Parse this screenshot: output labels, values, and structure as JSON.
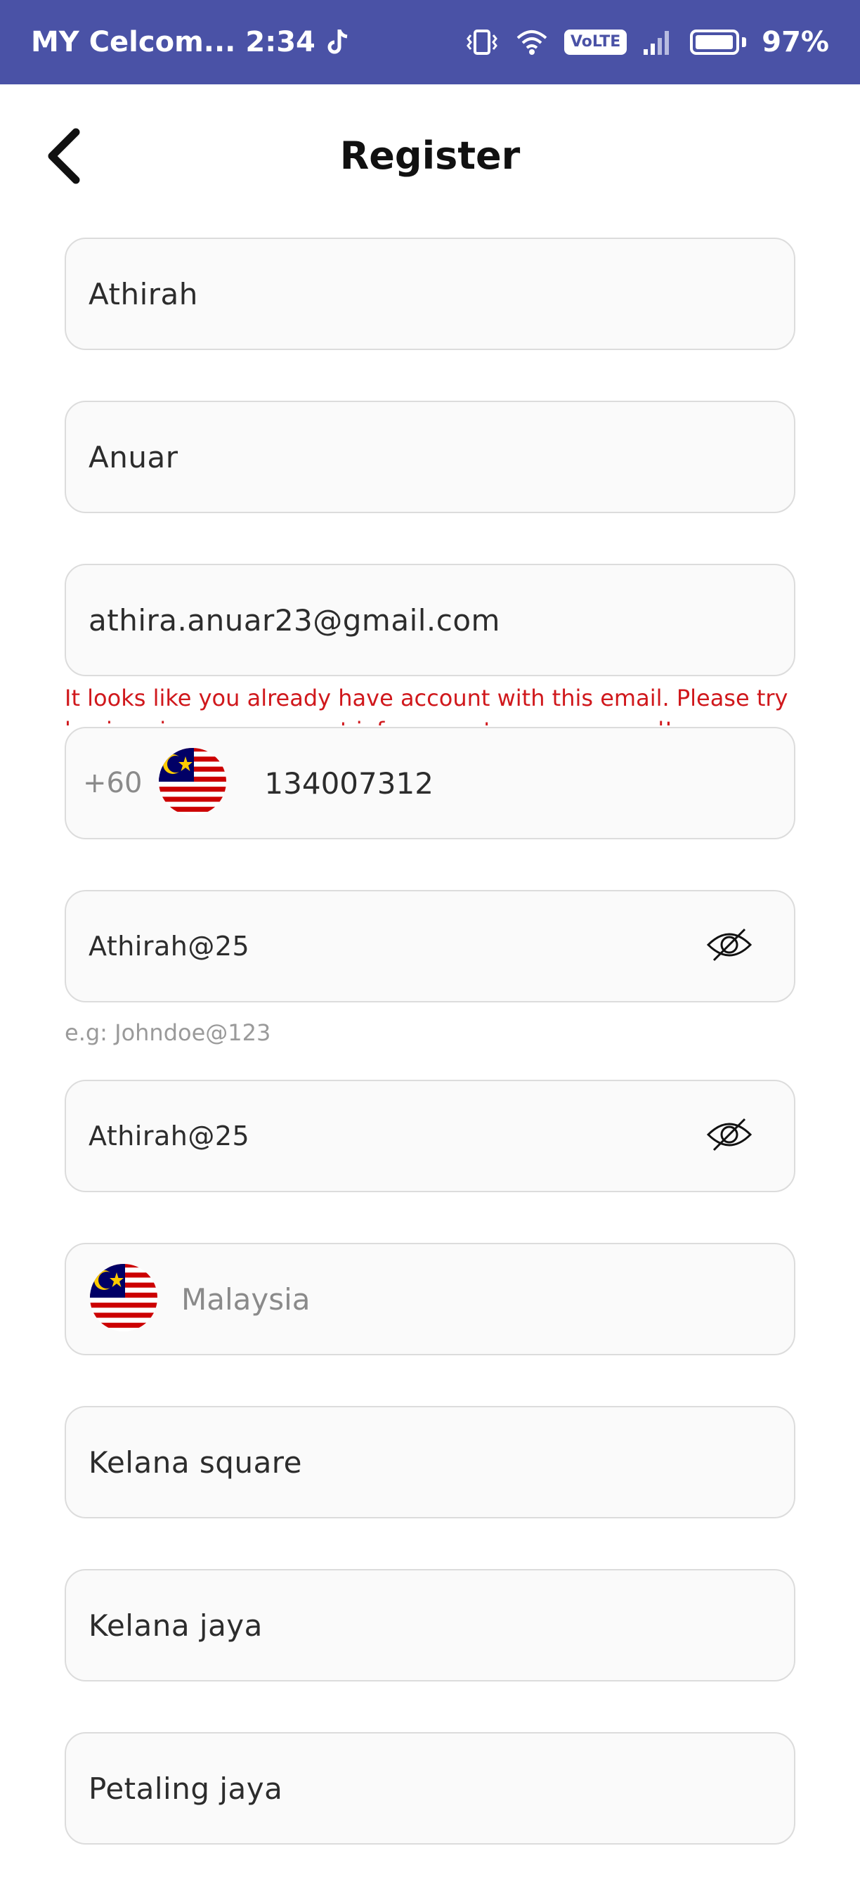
{
  "status_bar": {
    "carrier": "MY Celcom...",
    "time": "2:34",
    "volte": "VoLTE",
    "battery": "97%",
    "battery_level": 0.97
  },
  "header": {
    "title": "Register"
  },
  "form": {
    "first_name": "Athirah",
    "last_name": "Anuar",
    "email": "athira.anuar23@gmail.com",
    "email_error": "It looks like you already have account with this email. Please try log in using your account info or reset your password!",
    "phone": {
      "dial_code": "+60",
      "number": "134007312",
      "flag": "malaysia-flag-icon"
    },
    "password": "Athirah@25",
    "password_hint": "e.g: Johndoe@123",
    "confirm_password": "Athirah@25",
    "country": "Malaysia",
    "address_1": "Kelana square",
    "address_2": "Kelana jaya",
    "city": "Petaling jaya"
  },
  "colors": {
    "status_bar": "#4a52a6",
    "error": "#d0181c",
    "field_border": "#dcdcdc",
    "field_bg": "#fafafa"
  }
}
